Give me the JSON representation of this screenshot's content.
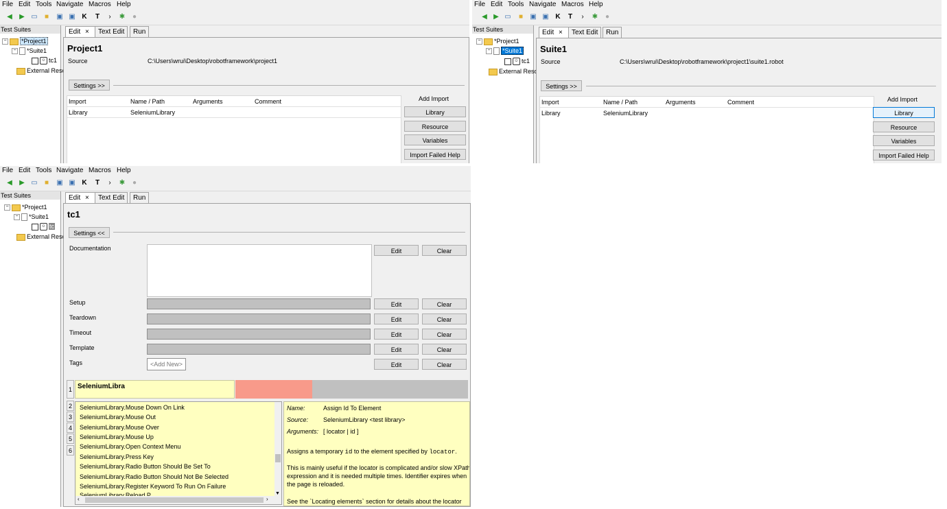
{
  "menus": [
    "File",
    "Edit",
    "Tools",
    "Navigate",
    "Macros",
    "Help"
  ],
  "toolbar_icons": [
    "back-arrow-icon",
    "forward-arrow-icon",
    "open-folder-icon",
    "folder-icon",
    "save-icon",
    "save-all-icon",
    "keyword-icon",
    "test-icon",
    "run-icon",
    "settings-icon",
    "stop-icon"
  ],
  "tree_title": "Test Suites",
  "tabs": {
    "edit": "Edit",
    "text_edit": "Text Edit",
    "run": "Run"
  },
  "win1": {
    "tree": {
      "project": "*Project1",
      "suite": "*Suite1",
      "test": "tc1",
      "external": "External Reso"
    },
    "title": "Project1",
    "source_label": "Source",
    "source_value": "C:\\Users\\wrui\\Desktop\\robotframework\\project1",
    "settings_button": "Settings >>",
    "import_headers": [
      "Import",
      "Name / Path",
      "Arguments",
      "Comment"
    ],
    "import_row": [
      "Library",
      "SeleniumLibrary"
    ],
    "add_import_label": "Add Import",
    "buttons": [
      "Library",
      "Resource",
      "Variables",
      "Import Failed Help"
    ]
  },
  "win2": {
    "tree": {
      "project": "*Project1",
      "suite": "*Suite1",
      "test": "tc1",
      "external": "External Reso"
    },
    "title": "Suite1",
    "source_label": "Source",
    "source_value": "C:\\Users\\wrui\\Desktop\\robotframework\\project1\\suite1.robot",
    "settings_button": "Settings >>",
    "import_headers": [
      "Import",
      "Name / Path",
      "Arguments",
      "Comment"
    ],
    "import_row": [
      "Library",
      "SeleniumLibrary"
    ],
    "add_import_label": "Add Import",
    "buttons": [
      "Library",
      "Resource",
      "Variables",
      "Import Failed Help"
    ]
  },
  "win3": {
    "tree": {
      "project": "*Project1",
      "suite": "*Suite1",
      "test": "tc",
      "external": "External Reso"
    },
    "title": "tc1",
    "settings_button": "Settings <<",
    "settings": [
      "Documentation",
      "Setup",
      "Teardown",
      "Timeout",
      "Template",
      "Tags"
    ],
    "edit_label": "Edit",
    "clear_label": "Clear",
    "add_new": "<Add New>",
    "row_numbers": [
      "1",
      "2",
      "3",
      "4",
      "5",
      "6"
    ],
    "cell_text": "SeleniumLibra",
    "autocomplete": [
      "SeleniumLibrary.Mouse Down On Link",
      "SeleniumLibrary.Mouse Out",
      "SeleniumLibrary.Mouse Over",
      "SeleniumLibrary.Mouse Up",
      "SeleniumLibrary.Open Context Menu",
      "SeleniumLibrary.Press Key",
      "SeleniumLibrary.Radio Button Should Be Set To",
      "SeleniumLibrary.Radio Button Should Not Be Selected",
      "SeleniumLibrary.Register Keyword To Run On Failure",
      "SeleniumLibrary.Reload P"
    ],
    "info": {
      "name_label": "Name:",
      "name_value": "Assign Id To Element",
      "source_label": "Source:",
      "source_value": "SeleniumLibrary <test library>",
      "args_label": "Arguments:",
      "args_value": "[ locator | id ]",
      "p1_a": "Assigns a temporary ",
      "p1_code1": "id",
      "p1_b": " to the element specified by ",
      "p1_code2": "locator",
      "p1_c": ".",
      "p2_l1": "This is mainly useful if the locator is complicated and/or slow XPath",
      "p2_l2": "expression and it is needed multiple times. Identifier expires when",
      "p2_l3": "the page is reloaded.",
      "p3": "See the `Locating elements` section for details about the locator"
    }
  }
}
